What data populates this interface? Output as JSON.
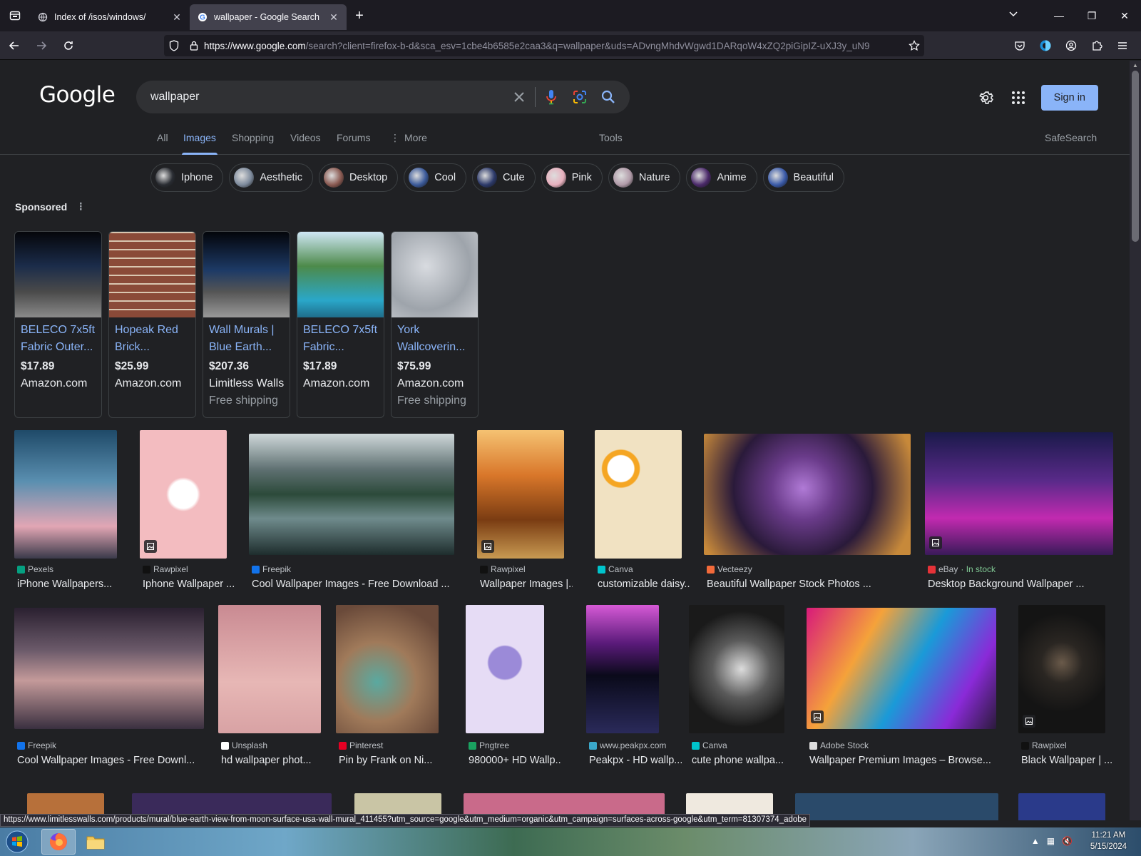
{
  "browser": {
    "tabs": [
      {
        "title": "Index of /isos/windows/",
        "active": false
      },
      {
        "title": "wallpaper - Google Search",
        "active": true
      }
    ],
    "url_host": "https://www.google.com",
    "url_rest": "/search?client=firefox-b-d&sca_esv=1cbe4b6585e2caa3&q=wallpaper&uds=ADvngMhdvWgwd1DARqoW4xZQ2piGipIZ-uXJ3y_uN9",
    "status_url": "https://www.limitlesswalls.com/products/mural/blue-earth-view-from-moon-surface-usa-wall-mural_411455?utm_source=google&utm_medium=organic&utm_campaign=surfaces-across-google&utm_term=81307374_adobe"
  },
  "google": {
    "logo": "Google",
    "query": "wallpaper",
    "sign_in": "Sign in",
    "tabs": [
      "All",
      "Images",
      "Shopping",
      "Videos",
      "Forums",
      "More",
      "Tools",
      "SafeSearch"
    ],
    "active_tab": "Images",
    "chips": [
      {
        "label": "Iphone",
        "color": "#2a2d33"
      },
      {
        "label": "Aesthetic",
        "color": "#7d8a9c"
      },
      {
        "label": "Desktop",
        "color": "#8a5a52"
      },
      {
        "label": "Cool",
        "color": "#3b5a9a"
      },
      {
        "label": "Cute",
        "color": "#2d3a6a"
      },
      {
        "label": "Pink",
        "color": "#e7b0be"
      },
      {
        "label": "Nature",
        "color": "#b09aa8"
      },
      {
        "label": "Anime",
        "color": "#4b2a6a"
      },
      {
        "label": "Beautiful",
        "color": "#3a5aa8"
      }
    ],
    "sponsored_label": "Sponsored",
    "ads": [
      {
        "title": "BELECO 7x5ft Fabric Outer...",
        "price": "$17.89",
        "store": "Amazon.com",
        "shipping": "",
        "bg": "linear-gradient(180deg,#05060a 0%,#1b2c4a 40%,#4a4a4a 70%,#8a8a8a 100%)"
      },
      {
        "title": "Hopeak Red Brick...",
        "price": "$25.99",
        "store": "Amazon.com",
        "shipping": "",
        "bg": "repeating-linear-gradient(0deg,#8a4a38 0 10px,#d9c6b0 10px 12px)"
      },
      {
        "title": "Wall Murals | Blue Earth...",
        "price": "$207.36",
        "store": "Limitless Walls",
        "shipping": "Free shipping",
        "bg": "linear-gradient(180deg,#03050a 0%,#1d3a66 45%,#555 70%,#999 100%)"
      },
      {
        "title": "BELECO 7x5ft Fabric...",
        "price": "$17.89",
        "store": "Amazon.com",
        "shipping": "",
        "bg": "linear-gradient(180deg,#cfe7f5 0%,#4d8a4a 40%,#2aa7c9 80%,#1f6d8a 100%)"
      },
      {
        "title": "York Wallcoverin...",
        "price": "$75.99",
        "store": "Amazon.com",
        "shipping": "Free shipping",
        "bg": "radial-gradient(circle at 40% 40%,#d8dbe0 0%,#9ea4ab 60%,#c9ccd1 100%)"
      }
    ],
    "results_row1": [
      {
        "source": "Pexels",
        "title": "iPhone Wallpapers...",
        "src_color": "#05a081",
        "bg": "linear-gradient(180deg,#1f4a68 0%,#5a8fb0 40%,#e2a6b4 75%,#3a3a4a 100%)",
        "badge": false
      },
      {
        "source": "Rawpixel",
        "title": "Iphone Wallpaper ...",
        "src_color": "#111111",
        "bg": "radial-gradient(circle,#ffffff 0 18%,#f3bcc0 22% 100%)",
        "badge": true
      },
      {
        "source": "Freepik",
        "title": "Cool Wallpaper Images - Free Download ...",
        "src_color": "#1273eb",
        "bg": "linear-gradient(180deg,#cfd8da 0%,#5d6f70 30%,#2c4a3a 50%,#6f8b8c 70%,#1e2d2d 100%)",
        "badge": false
      },
      {
        "source": "Rawpixel",
        "title": "Wallpaper Images |...",
        "src_color": "#111111",
        "bg": "linear-gradient(180deg,#f5c272 0%,#d9772a 35%,#7a3c12 70%,#c89a52 100%)",
        "badge": true
      },
      {
        "source": "Canva",
        "title": "customizable daisy...",
        "src_color": "#00c4cc",
        "bg": "radial-gradient(circle at 30% 30%,#ffffff 0 12%,#f5a623 13% 17%,#f1e2c2 18% 100%)",
        "badge": false
      },
      {
        "source": "Vecteezy",
        "title": "Beautiful Wallpaper Stock Photos ...",
        "src_color": "#f26a3a",
        "bg": "radial-gradient(circle at 48% 45%,#b07ad6 0%,#6a3b8a 25%,#2a1a3a 55%,#c7893a 90%)",
        "badge": false
      },
      {
        "source": "eBay",
        "stock": "· In stock",
        "title": "Desktop Background Wallpaper ...",
        "src_color": "#e53238",
        "bg": "linear-gradient(180deg,#1a1a4a 0%,#5a2a8a 40%,#c22ab0 70%,#3a1a5a 100%)",
        "badge": true
      }
    ],
    "results_row2": [
      {
        "source": "Freepik",
        "title": "Cool Wallpaper Images - Free Downl...",
        "src_color": "#1273eb",
        "bg": "linear-gradient(180deg,#2a2030 0%,#6b5a6a 35%,#c49a9a 60%,#3a3040 100%)",
        "badge": false
      },
      {
        "source": "Unsplash",
        "title": "hd wallpaper phot...",
        "src_color": "#ffffff",
        "bg": "linear-gradient(180deg,#c98a92 0%,#e7b7b5 60%,#d8a2a4 100%)",
        "badge": false
      },
      {
        "source": "Pinterest",
        "title": "Pin by Frank on Ni...",
        "src_color": "#e60023",
        "bg": "radial-gradient(circle at 40% 60%,#5aa9a0 0%,#a07a5a 40%,#6a4a3a 80%)",
        "badge": false
      },
      {
        "source": "Pngtree",
        "title": "980000+ HD Wallp...",
        "src_color": "#1aa260",
        "bg": "radial-gradient(circle at 50% 45%,#9b8ad8 0 20%,#e6dcf5 22% 100%)",
        "badge": false
      },
      {
        "source": "www.peakpx.com",
        "title": "Peakpx - HD wallp...",
        "src_color": "#3aa7c9",
        "bg": "linear-gradient(180deg,#d65ad6 0%,#5a1a7a 30%,#0a0a1a 55%,#2a2a5a 100%)",
        "badge": false
      },
      {
        "source": "Canva",
        "title": "cute phone wallpa...",
        "src_color": "#00c4cc",
        "bg": "radial-gradient(circle at 55% 50%,#dcdcdc 0%,#5a5a5a 35%,#1a1a1a 70%)",
        "badge": false
      },
      {
        "source": "Adobe Stock",
        "title": "Wallpaper Premium Images – Browse...",
        "src_color": "#dddddd",
        "bg": "linear-gradient(120deg,#d81a7a 0%,#f5a23a 30%,#1a9ad8 55%,#8a2ad8 80%,#2a1a3a 100%)",
        "badge": true
      },
      {
        "source": "Rawpixel",
        "title": "Black Wallpaper | ...",
        "src_color": "#111111",
        "bg": "radial-gradient(circle at 50% 45%,#6a5a4a 0%,#2a2622 25%,#141414 60%)",
        "badge": true
      }
    ],
    "row3_colors": [
      "#b7703a",
      "#3a2a5a",
      "#c9c5a5",
      "#c96a8a",
      "#efe9df",
      "#2a4a6a",
      "#2a3a8a"
    ]
  },
  "taskbar": {
    "time": "11:21 AM",
    "date": "5/15/2024"
  }
}
